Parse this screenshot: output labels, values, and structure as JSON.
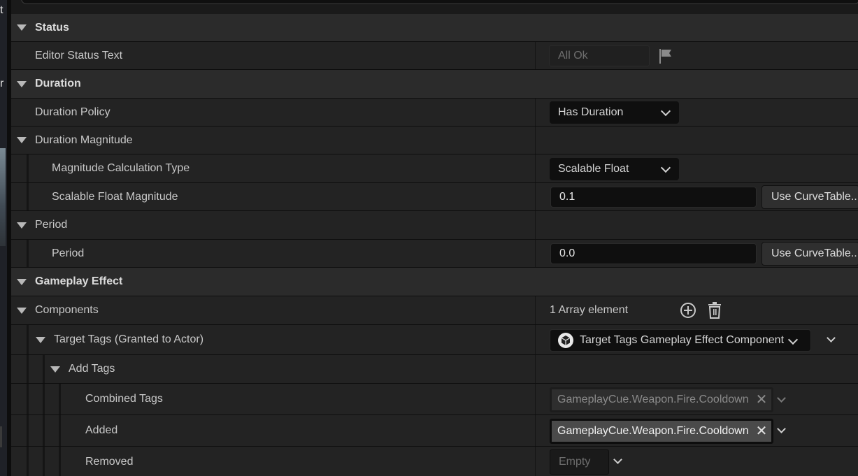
{
  "left_fragments": [
    "t",
    "r"
  ],
  "rows": {
    "status_cat": "Status",
    "editor_status_text": {
      "label": "Editor Status Text",
      "value": "All Ok"
    },
    "duration_cat": "Duration",
    "duration_policy": {
      "label": "Duration Policy",
      "value": "Has Duration"
    },
    "duration_magnitude": "Duration Magnitude",
    "magnitude_calc_type": {
      "label": "Magnitude Calculation Type",
      "value": "Scalable Float"
    },
    "scalable_float_magnitude": {
      "label": "Scalable Float Magnitude",
      "value": "0.1",
      "button": "Use CurveTable..."
    },
    "period_group": "Period",
    "period": {
      "label": "Period",
      "value": "0.0",
      "button": "Use CurveTable..."
    },
    "gameplay_effect_cat": "Gameplay Effect",
    "components": {
      "label": "Components",
      "value": "1 Array element"
    },
    "target_tags": {
      "label": "Target Tags (Granted to Actor)",
      "value": "Target Tags Gameplay Effect Component"
    },
    "add_tags": "Add Tags",
    "combined_tags": {
      "label": "Combined Tags",
      "tag": "GameplayCue.Weapon.Fire.Cooldown"
    },
    "added": {
      "label": "Added",
      "tag": "GameplayCue.Weapon.Fire.Cooldown"
    },
    "removed": {
      "label": "Removed",
      "value": "Empty"
    }
  }
}
